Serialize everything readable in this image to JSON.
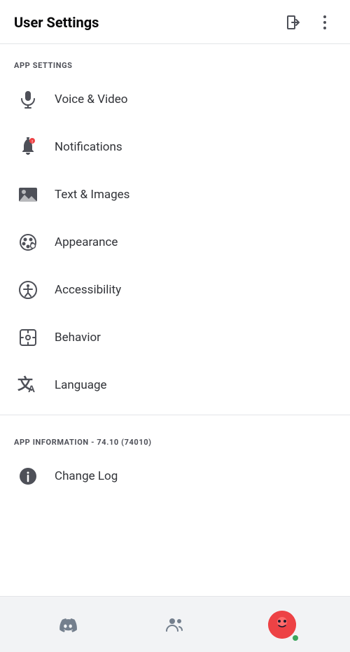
{
  "header": {
    "title": "User Settings",
    "logout_icon": "login-icon",
    "more_icon": "more-vertical-icon"
  },
  "app_settings_section": {
    "label": "APP SETTINGS",
    "items": [
      {
        "id": "voice-video",
        "label": "Voice & Video",
        "icon": "microphone-icon"
      },
      {
        "id": "notifications",
        "label": "Notifications",
        "icon": "bell-icon"
      },
      {
        "id": "text-images",
        "label": "Text & Images",
        "icon": "image-icon"
      },
      {
        "id": "appearance",
        "label": "Appearance",
        "icon": "palette-icon"
      },
      {
        "id": "accessibility",
        "label": "Accessibility",
        "icon": "accessibility-icon"
      },
      {
        "id": "behavior",
        "label": "Behavior",
        "icon": "behavior-icon"
      },
      {
        "id": "language",
        "label": "Language",
        "icon": "language-icon"
      }
    ]
  },
  "app_info_section": {
    "label": "APP INFORMATION - 74.10 (74010)",
    "items": [
      {
        "id": "change-log",
        "label": "Change Log",
        "icon": "info-icon"
      }
    ]
  },
  "bottom_nav": {
    "items": [
      {
        "id": "home",
        "icon": "discord-icon"
      },
      {
        "id": "friends",
        "icon": "person-icon"
      },
      {
        "id": "profile",
        "icon": "avatar-icon"
      }
    ]
  }
}
